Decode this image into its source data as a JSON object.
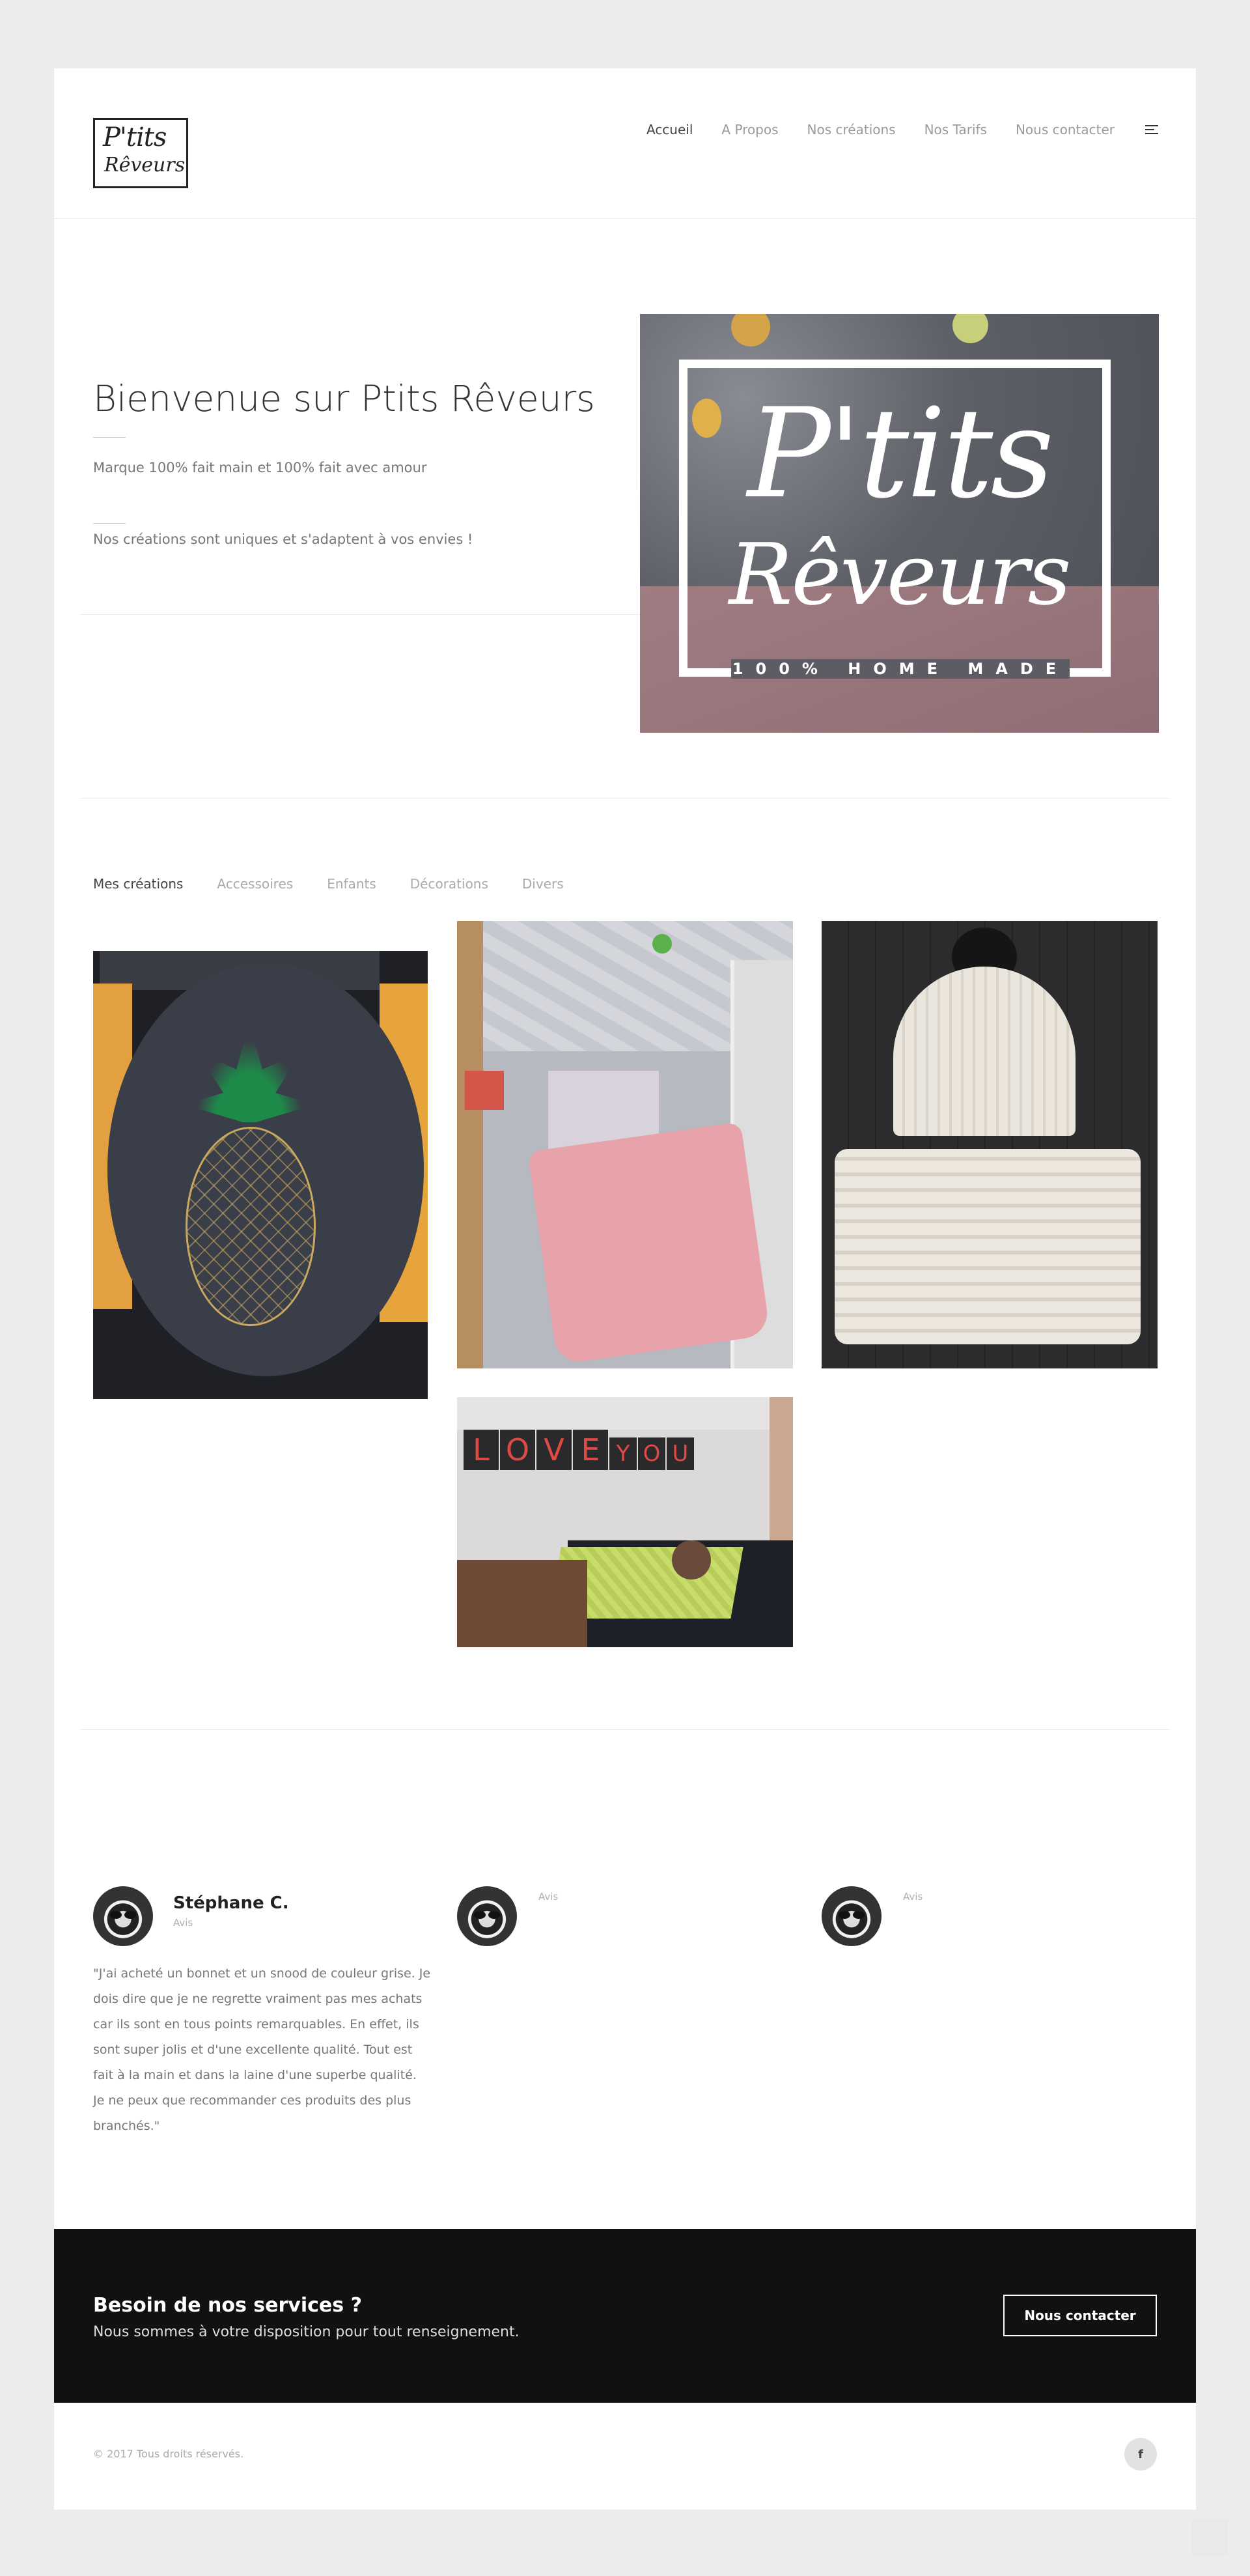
{
  "brand": {
    "logo_line1": "P'tits",
    "logo_line2": "Rêveurs"
  },
  "nav": {
    "items": [
      {
        "label": "Accueil"
      },
      {
        "label": "A Propos"
      },
      {
        "label": "Nos créations"
      },
      {
        "label": "Nos Tarifs"
      },
      {
        "label": "Nous contacter"
      }
    ]
  },
  "hero": {
    "title": "Bienvenue sur Ptits Rêveurs",
    "subtitle1": "Marque 100% fait main et 100% fait avec amour",
    "subtitle2": "Nos créations sont uniques et s'adaptent à vos envies !",
    "image_text_line1": "P'tits",
    "image_text_line2": "Rêveurs",
    "image_text_line3": "100% HOME MADE"
  },
  "gallery": {
    "filters": [
      {
        "label": "Mes créations"
      },
      {
        "label": "Accessoires"
      },
      {
        "label": "Enfants"
      },
      {
        "label": "Décorations"
      },
      {
        "label": "Divers"
      }
    ],
    "wall_letters": [
      "L",
      "O",
      "V",
      "E",
      "Y",
      "O",
      "U"
    ]
  },
  "testimonials": {
    "items": [
      {
        "name": "Stéphane C.",
        "label": "Avis",
        "quote": "\"J'ai acheté un bonnet et un snood de couleur grise. Je dois dire que je ne regrette vraiment pas mes achats car ils sont en tous points remarquables. En effet, ils sont super jolis et d'une excellente qualité. Tout est fait à la main et dans la laine d'une superbe qualité. Je ne peux que recommander ces produits des plus branchés.\""
      },
      {
        "name": "",
        "label": "Avis"
      },
      {
        "name": "",
        "label": "Avis"
      }
    ]
  },
  "cta": {
    "title": "Besoin de nos services ?",
    "text": "Nous sommes à votre disposition pour tout renseignement.",
    "button_label": "Nous contacter"
  },
  "footer": {
    "copyright": "© 2017 Tous droits réservés.",
    "social_icon_label": "f"
  },
  "colors": {
    "dark": "#111111",
    "page_bg": "#ececec",
    "card_bg": "#ffffff"
  }
}
